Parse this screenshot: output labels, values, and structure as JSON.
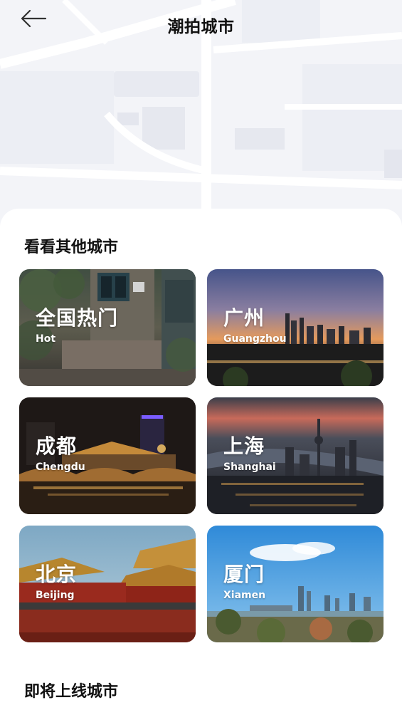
{
  "header": {
    "title": "潮拍城市",
    "back_icon": "back-arrow-icon"
  },
  "sections": {
    "other_cities_title": "看看其他城市",
    "upcoming_title": "即将上线城市"
  },
  "cities": [
    {
      "cn": "全国热门",
      "en": "Hot"
    },
    {
      "cn": "广州",
      "en": "Guangzhou"
    },
    {
      "cn": "成都",
      "en": "Chengdu"
    },
    {
      "cn": "上海",
      "en": "Shanghai"
    },
    {
      "cn": "北京",
      "en": "Beijing"
    },
    {
      "cn": "厦门",
      "en": "Xiamen"
    }
  ],
  "colors": {
    "sheet": "#ffffff",
    "map_background": "#f3f4f8",
    "title_text": "#111111",
    "card_text": "#ffffff"
  }
}
